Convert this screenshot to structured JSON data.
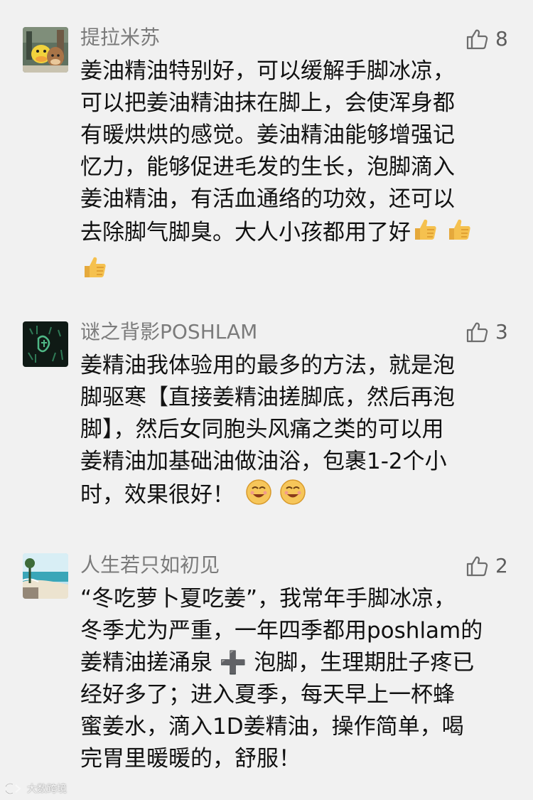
{
  "comments": [
    {
      "username": "提拉米苏",
      "likes": "8",
      "lines": [
        "姜油精油特别好，可以缓解手脚冰凉，",
        "可以把姜油精油抹在脚上，会使浑身都",
        "有暖烘烘的感觉。姜油精油能够增强记",
        "忆力，能够促进毛发的生长，泡脚滴入",
        "姜油精油，有活血通络的功效，还可以",
        "去除脚气脚臭。大人小孩都用了好"
      ]
    },
    {
      "username": "谜之背影POSHLAM",
      "likes": "3",
      "lines": [
        "姜精油我体验用的最多的方法，就是泡",
        "脚驱寒【直接姜精油搓脚底，然后再泡",
        "脚】，然后女同胞头风痛之类的可以用",
        "姜精油加基础油做油浴，包裹1-2个小",
        "时，效果很好！"
      ]
    },
    {
      "username": "人生若只如初见",
      "likes": "2",
      "lines": [
        "“冬吃萝卜夏吃姜”，我常年手脚冰凉，",
        "冬季尤为严重，一年四季都用poshlam的",
        "姜精油搓涌泉 ➕ 泡脚，生理期肚子疼已",
        "经好多了；进入夏季，每天早上一杯蜂",
        "蜜姜水，滴入1D姜精油，操作简单，喝",
        "完胃里暖暖的，舒服！"
      ]
    }
  ],
  "watermark": "大数跨境",
  "colors": {
    "background": "#f1f1f1",
    "username": "#7b7b7b",
    "text": "#111111"
  },
  "icons": [
    "thumbs-up-outline-icon",
    "thumbs-up-emoji-icon",
    "smiling-emoji-icon",
    "plus-icon"
  ]
}
